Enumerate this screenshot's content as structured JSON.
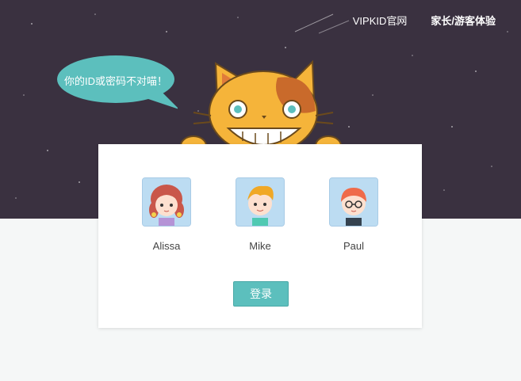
{
  "nav": {
    "official_link": "VIPKID官网",
    "guest_link": "家长/游客体验"
  },
  "bubble": {
    "message": "你的ID或密码不对喵！"
  },
  "users": [
    {
      "name": "Alissa",
      "icon": "girl-avatar-icon"
    },
    {
      "name": "Mike",
      "icon": "boy-blond-avatar-icon"
    },
    {
      "name": "Paul",
      "icon": "boy-glasses-avatar-icon"
    }
  ],
  "login": {
    "label": "登录"
  },
  "colors": {
    "sky": "#3a3140",
    "accent": "#5cbfbd",
    "cat": "#f5b43a"
  }
}
